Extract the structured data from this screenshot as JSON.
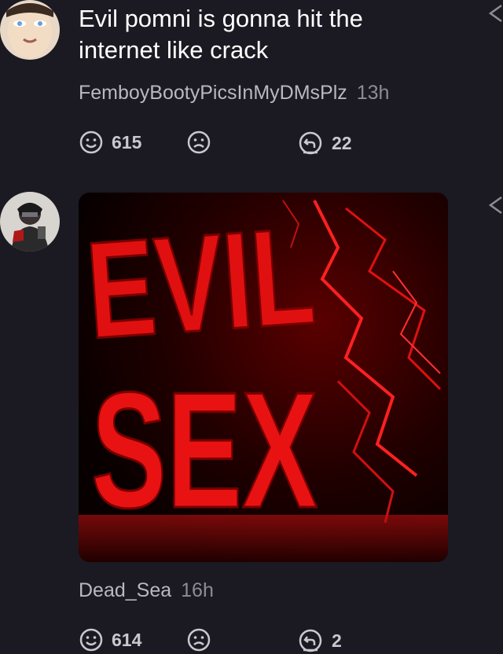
{
  "comments": [
    {
      "text": "Evil pomni is gonna hit the internet like crack",
      "author": "FemboyBootyPicsInMyDMsPlz",
      "time": "13h",
      "likes": "615",
      "replies": "22"
    },
    {
      "image_words": [
        "EVIL",
        "SEX"
      ],
      "author": "Dead_Sea",
      "time": "16h",
      "likes": "614",
      "replies": "2"
    }
  ],
  "icons": {
    "like": "smile-icon",
    "dislike": "frown-icon",
    "reply": "reply-icon",
    "share": "share-icon"
  },
  "colors": {
    "background": "#1b1a22",
    "text": "#ffffff",
    "meta": "#b9b8bf",
    "accent_red": "#e01010"
  }
}
